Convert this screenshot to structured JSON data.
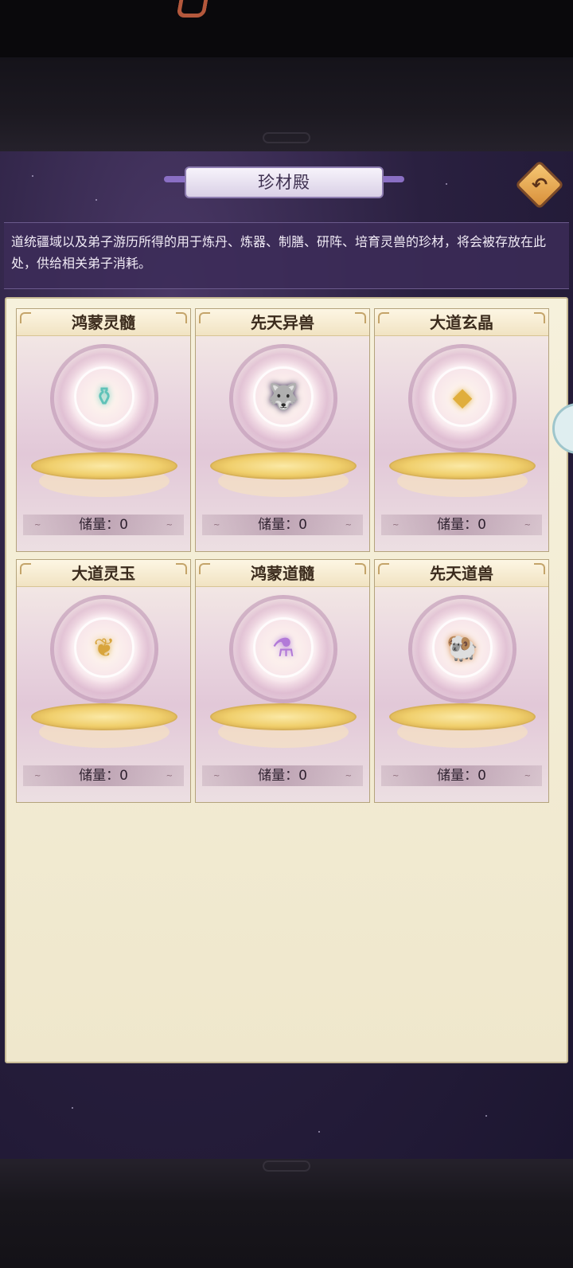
{
  "header": {
    "title": "珍材殿",
    "back_icon": "back-arrow-icon"
  },
  "description": "道统疆域以及弟子游历所得的用于炼丹、炼器、制膳、研阵、培育灵兽的珍材，将会被存放在此处，供给相关弟子消耗。",
  "items": [
    {
      "name": "鸿蒙灵髓",
      "stock": "储量：0",
      "icon": "spirit-bottle-icon",
      "glyph": "⚱",
      "color": "#5fc2b8"
    },
    {
      "name": "先天异兽",
      "stock": "储量：0",
      "icon": "shadow-beast-icon",
      "glyph": "🐺",
      "color": "#3a2c5a"
    },
    {
      "name": "大道玄晶",
      "stock": "储量：0",
      "icon": "gold-crystal-icon",
      "glyph": "◆",
      "color": "#e0ae3c"
    },
    {
      "name": "大道灵玉",
      "stock": "储量：0",
      "icon": "gold-jade-icon",
      "glyph": "❦",
      "color": "#d8a43c"
    },
    {
      "name": "鸿蒙道髓",
      "stock": "储量：0",
      "icon": "purple-gourd-icon",
      "glyph": "⚗",
      "color": "#b27ad8"
    },
    {
      "name": "先天道兽",
      "stock": "储量：0",
      "icon": "golden-beast-icon",
      "glyph": "🐏",
      "color": "#d49058"
    }
  ],
  "colors": {
    "panel_bg": "#f6f1dc",
    "accent": "#3a2a1c",
    "main_bg": "#2a2040"
  }
}
